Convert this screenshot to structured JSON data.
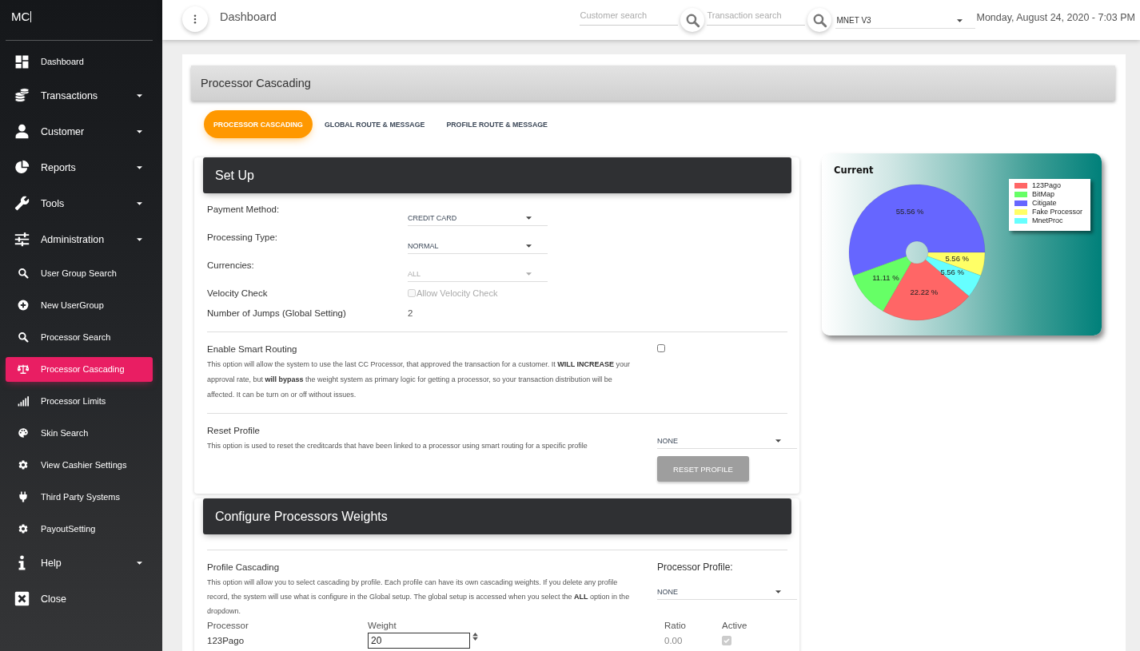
{
  "sidebar": {
    "logo": "MC",
    "items": [
      {
        "label": "Dashboard",
        "kind": "link",
        "selected": false
      },
      {
        "label": "Transactions",
        "kind": "group",
        "selected": false
      },
      {
        "label": "Customer",
        "kind": "group",
        "selected": false
      },
      {
        "label": "Reports",
        "kind": "group",
        "selected": false
      },
      {
        "label": "Tools",
        "kind": "group",
        "selected": false
      },
      {
        "label": "Administration",
        "kind": "group",
        "selected": false
      },
      {
        "label": "User Group Search",
        "kind": "link",
        "selected": false
      },
      {
        "label": "New UserGroup",
        "kind": "link",
        "selected": false
      },
      {
        "label": "Processor Search",
        "kind": "link",
        "selected": false
      },
      {
        "label": "Processor Cascading",
        "kind": "link",
        "selected": true
      },
      {
        "label": "Processor Limits",
        "kind": "link",
        "selected": false
      },
      {
        "label": "Skin Search",
        "kind": "link",
        "selected": false
      },
      {
        "label": "View Cashier Settings",
        "kind": "link",
        "selected": false
      },
      {
        "label": "Third Party Systems",
        "kind": "link",
        "selected": false
      },
      {
        "label": "PayoutSetting",
        "kind": "link",
        "selected": false
      },
      {
        "label": "Help",
        "kind": "group",
        "selected": false
      },
      {
        "label": "Close",
        "kind": "action",
        "selected": false
      }
    ]
  },
  "topbar": {
    "title": "Dashboard",
    "customer_search": {
      "placeholder": "Customer search"
    },
    "transaction_search": {
      "placeholder": "Transaction search"
    },
    "site_select": {
      "value": "MNET V3"
    },
    "datetime": "Monday, August 24, 2020 - 7:03 PM"
  },
  "page": {
    "title": "Processor Cascading",
    "tabs": [
      {
        "label": "PROCESSOR CASCADING",
        "selected": true
      },
      {
        "label": "GLOBAL ROUTE & MESSAGE",
        "selected": false
      },
      {
        "label": "PROFILE ROUTE & MESSAGE",
        "selected": false
      }
    ]
  },
  "setup": {
    "title": "Set Up",
    "fields": [
      {
        "label": "Payment Method:",
        "kind": "select",
        "value": "CREDIT CARD",
        "disabled": false
      },
      {
        "label": "Processing Type:",
        "kind": "select",
        "value": "NORMAL",
        "disabled": false
      },
      {
        "label": "Currencies:",
        "kind": "select",
        "value": "ALL",
        "disabled": true
      },
      {
        "label": "Velocity Check",
        "kind": "checkbox",
        "option": "Allow Velocity Check",
        "checked": false,
        "disabled": true
      },
      {
        "label": "Number of Jumps (Global Setting)",
        "kind": "text",
        "value": "2",
        "disabled": false
      }
    ],
    "smart_routing": {
      "title": "Enable Smart Routing",
      "description": "This option will allow the system to use the last CC Processor, that approved the transaction for a customer. It **WILL INCREASE** your approval rate, but **will bypass** the weight system as primary logic for getting a processor, so your transaction distribution will be affected. It can be turn on or off without issues.",
      "checked": false
    },
    "reset_profile": {
      "title": "Reset Profile",
      "description": "This option is used to reset the creditcards that have been linked to a processor using smart routing for a specific profile",
      "select_value": "NONE",
      "button": "RESET PROFILE"
    }
  },
  "weights": {
    "title": "Configure Processors Weights",
    "profile_cascading": {
      "title": "Profile Cascading",
      "description": "This option will allow you to select cascading by profile. Each profile can have its own cascading weights. If you delete any profile record, the system will use what is configure in the Global setup. The global setup is accessed when you select the **ALL** option in the dropdown."
    },
    "processor_profile": {
      "label": "Processor Profile:",
      "value": "NONE"
    },
    "columns": [
      "Processor",
      "Weight",
      "Ratio",
      "Active"
    ],
    "rows": [
      {
        "processor": "123Pago",
        "weight": "20",
        "ratio": "0.00",
        "active": true
      }
    ]
  },
  "chart_panel": {
    "chart_data": {
      "type": "donut",
      "title": "Current",
      "categories": [
        "123Pago",
        "BitMap",
        "Citigate",
        "Fake Processor",
        "MnetProc"
      ],
      "values": [
        22.22,
        11.11,
        55.56,
        5.56,
        5.56
      ],
      "colors": [
        "#ff6666",
        "#66ff66",
        "#6666ff",
        "#ffff66",
        "#66ffff"
      ],
      "value_labels": [
        "22.22 %",
        "11.11 %",
        "55.56 %",
        "5.56 %",
        "5.56 %"
      ],
      "legend": "top-right"
    }
  }
}
